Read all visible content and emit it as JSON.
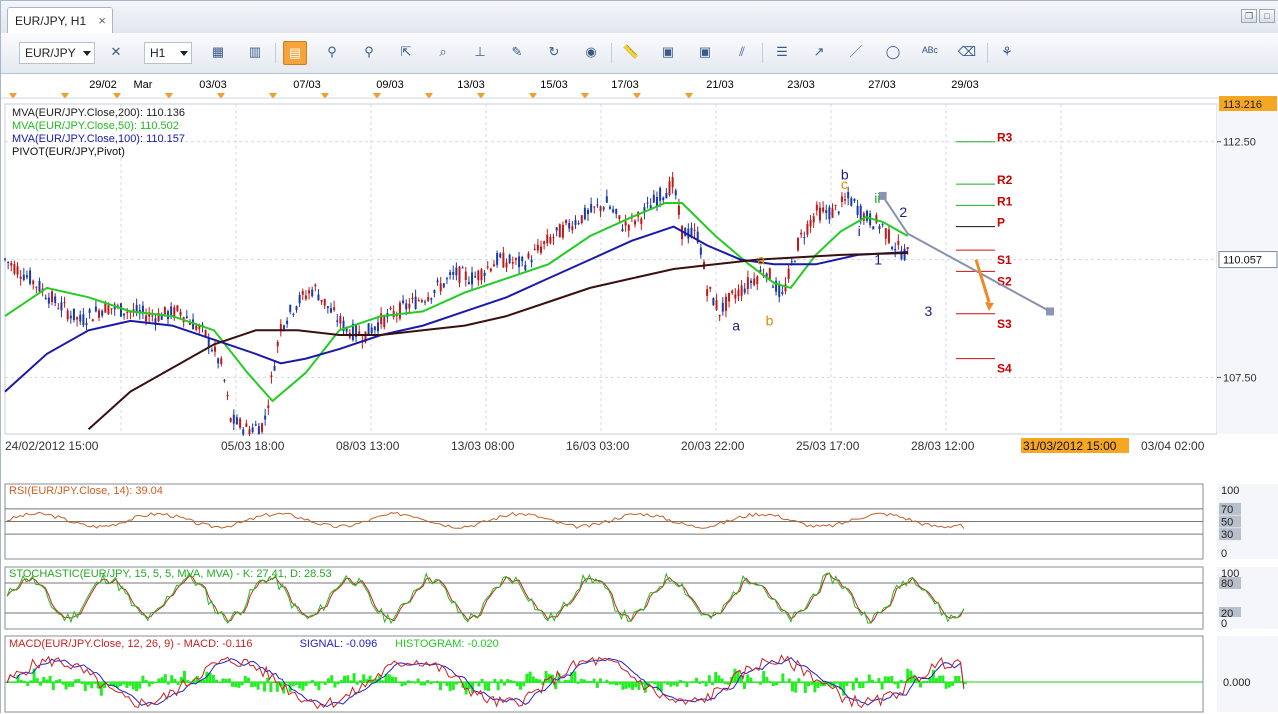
{
  "window": {
    "tab_title": "EUR/JPY, H1",
    "close_glyph": "×",
    "restore_glyph": "❐",
    "maximize_glyph": "□"
  },
  "toolbar": {
    "symbol": "EUR/JPY",
    "timeframe": "H1",
    "icons": [
      "bar-chart-icon",
      "crosshair-icon",
      "candle-view-icon",
      "line-view-icon",
      "zoom-in-icon",
      "zoom-out-icon",
      "cursor-icon",
      "zoom-area-icon",
      "indicator-icon",
      "draw-icon",
      "refresh-icon",
      "globe-icon",
      "ruler-icon",
      "template-icon",
      "screenshot-icon",
      "fibonacci-icon",
      "channel-icon",
      "trend-tool-icon",
      "line-tool-icon",
      "ellipse-icon",
      "text-tool-icon",
      "eraser-icon",
      "objects-icon"
    ]
  },
  "top_dates": [
    "29/02",
    "Mar",
    "03/03",
    "07/03",
    "09/03",
    "13/03",
    "15/03",
    "17/03",
    "21/03",
    "23/03",
    "27/03",
    "29/03"
  ],
  "legend": [
    {
      "text": "MVA(EUR/JPY.Close,200): 110.136",
      "color": "#222222"
    },
    {
      "text": "MVA(EUR/JPY.Close,50): 110.502",
      "color": "#22bb22"
    },
    {
      "text": "MVA(EUR/JPY.Close,100): 110.157",
      "color": "#1a1aaa"
    },
    {
      "text": "PIVOT(EUR/JPY,Pivot)",
      "color": "#111111"
    }
  ],
  "chart_data": [
    {
      "type": "candlestick",
      "title": "EUR/JPY, H1",
      "y_ticks": [
        112.5,
        110.0,
        107.5
      ],
      "y_tick_labels": [
        "112.50",
        "110.057",
        "107.50"
      ],
      "ylim": [
        106.3,
        113.3
      ],
      "current_price": "110.057",
      "top_price": "113.216",
      "x_tick_labels": [
        "24/02/2012 15:00",
        "05/03 18:00",
        "08/03 13:00",
        "13/03 08:00",
        "16/03 03:00",
        "20/03 22:00",
        "25/03 17:00",
        "28/03 12:00",
        "31/03/2012 15:00",
        "03/04 02:00"
      ],
      "close_path": [
        [
          0,
          110.0
        ],
        [
          6,
          109.6
        ],
        [
          12,
          109.1
        ],
        [
          18,
          108.7
        ],
        [
          24,
          109.0
        ],
        [
          30,
          108.9
        ],
        [
          36,
          108.8
        ],
        [
          42,
          108.9
        ],
        [
          48,
          108.4
        ],
        [
          52,
          107.7
        ],
        [
          54,
          106.6
        ],
        [
          58,
          106.4
        ],
        [
          62,
          106.5
        ],
        [
          66,
          108.6
        ],
        [
          70,
          109.1
        ],
        [
          74,
          109.4
        ],
        [
          78,
          108.9
        ],
        [
          82,
          108.5
        ],
        [
          86,
          108.4
        ],
        [
          90,
          108.7
        ],
        [
          96,
          109.0
        ],
        [
          102,
          109.3
        ],
        [
          108,
          109.7
        ],
        [
          112,
          109.6
        ],
        [
          118,
          110.0
        ],
        [
          124,
          109.9
        ],
        [
          130,
          110.4
        ],
        [
          136,
          110.8
        ],
        [
          140,
          111.0
        ],
        [
          144,
          111.2
        ],
        [
          148,
          110.7
        ],
        [
          152,
          110.9
        ],
        [
          156,
          111.3
        ],
        [
          160,
          111.6
        ],
        [
          162,
          110.6
        ],
        [
          166,
          110.5
        ],
        [
          168,
          109.4
        ],
        [
          171,
          108.9
        ],
        [
          174,
          109.2
        ],
        [
          178,
          109.5
        ],
        [
          182,
          109.8
        ],
        [
          186,
          109.2
        ],
        [
          190,
          110.4
        ],
        [
          194,
          111.0
        ],
        [
          198,
          111.0
        ],
        [
          202,
          111.3
        ],
        [
          206,
          110.9
        ],
        [
          210,
          110.7
        ],
        [
          212,
          110.4
        ],
        [
          214,
          110.2
        ],
        [
          216,
          110.1
        ]
      ],
      "x_total": 290,
      "series": [
        {
          "name": "MVA(EUR/JPY.Close,50)",
          "color": "#22cc22",
          "values": [
            [
              0,
              108.8
            ],
            [
              10,
              109.4
            ],
            [
              20,
              109.2
            ],
            [
              30,
              108.9
            ],
            [
              40,
              108.8
            ],
            [
              50,
              108.5
            ],
            [
              58,
              107.6
            ],
            [
              64,
              107.0
            ],
            [
              72,
              107.6
            ],
            [
              80,
              108.5
            ],
            [
              90,
              108.8
            ],
            [
              100,
              108.9
            ],
            [
              110,
              109.3
            ],
            [
              120,
              109.6
            ],
            [
              130,
              109.9
            ],
            [
              140,
              110.5
            ],
            [
              150,
              110.9
            ],
            [
              158,
              111.2
            ],
            [
              162,
              111.2
            ],
            [
              170,
              110.5
            ],
            [
              178,
              109.9
            ],
            [
              184,
              109.5
            ],
            [
              188,
              109.4
            ],
            [
              194,
              110.1
            ],
            [
              200,
              110.6
            ],
            [
              206,
              110.9
            ],
            [
              210,
              110.8
            ],
            [
              216,
              110.5
            ]
          ]
        },
        {
          "name": "MVA(EUR/JPY.Close,100)",
          "color": "#1a1aaa",
          "values": [
            [
              0,
              107.2
            ],
            [
              10,
              108.0
            ],
            [
              20,
              108.5
            ],
            [
              30,
              108.7
            ],
            [
              40,
              108.6
            ],
            [
              50,
              108.3
            ],
            [
              60,
              108.0
            ],
            [
              66,
              107.8
            ],
            [
              72,
              107.9
            ],
            [
              80,
              108.1
            ],
            [
              90,
              108.4
            ],
            [
              100,
              108.6
            ],
            [
              110,
              108.9
            ],
            [
              120,
              109.2
            ],
            [
              130,
              109.6
            ],
            [
              140,
              110.0
            ],
            [
              150,
              110.4
            ],
            [
              160,
              110.7
            ],
            [
              168,
              110.3
            ],
            [
              176,
              110.0
            ],
            [
              184,
              109.9
            ],
            [
              194,
              109.9
            ],
            [
              204,
              110.1
            ],
            [
              216,
              110.16
            ]
          ]
        },
        {
          "name": "MVA(EUR/JPY.Close,200)",
          "color": "#3a1010",
          "values": [
            [
              20,
              106.4
            ],
            [
              30,
              107.2
            ],
            [
              40,
              107.7
            ],
            [
              50,
              108.2
            ],
            [
              60,
              108.5
            ],
            [
              70,
              108.5
            ],
            [
              80,
              108.4
            ],
            [
              90,
              108.4
            ],
            [
              100,
              108.5
            ],
            [
              110,
              108.6
            ],
            [
              120,
              108.8
            ],
            [
              130,
              109.1
            ],
            [
              140,
              109.4
            ],
            [
              150,
              109.6
            ],
            [
              160,
              109.8
            ],
            [
              170,
              109.9
            ],
            [
              180,
              110.0
            ],
            [
              190,
              110.05
            ],
            [
              200,
              110.1
            ],
            [
              216,
              110.14
            ]
          ]
        }
      ],
      "pivot_levels": [
        {
          "name": "R3",
          "value": 112.5
        },
        {
          "name": "R2",
          "value": 111.6
        },
        {
          "name": "R1",
          "value": 111.15
        },
        {
          "name": "P",
          "value": 110.7
        },
        {
          "name": "S1",
          "value": 110.2
        },
        {
          "name": "S2",
          "value": 109.75
        },
        {
          "name": "S3",
          "value": 108.85
        },
        {
          "name": "S4",
          "value": 107.9
        }
      ],
      "annotations": [
        {
          "text": "a",
          "x": 174,
          "y": 108.5,
          "color": "#1a1a88"
        },
        {
          "text": "b",
          "x": 182,
          "y": 108.6,
          "color": "#e08a00"
        },
        {
          "text": "a",
          "x": 180,
          "y": 109.9,
          "color": "#e08a00"
        },
        {
          "text": "b",
          "x": 200,
          "y": 111.7,
          "color": "#1a1a88"
        },
        {
          "text": "c",
          "x": 200,
          "y": 111.5,
          "color": "#e08a00"
        },
        {
          "text": "ii",
          "x": 208,
          "y": 111.2,
          "color": "#22aa22"
        },
        {
          "text": "i",
          "x": 204,
          "y": 110.5,
          "color": "#1a1a88"
        },
        {
          "text": "1",
          "x": 208,
          "y": 109.9,
          "color": "#1a1a88"
        },
        {
          "text": "2",
          "x": 214,
          "y": 110.9,
          "color": "#1a1a88"
        },
        {
          "text": "3",
          "x": 220,
          "y": 108.8,
          "color": "#1a1a88"
        }
      ]
    },
    {
      "type": "line",
      "title": "RSI(EUR/JPY.Close, 14): 39.04",
      "y_tick_labels": [
        "100",
        "70",
        "50",
        "30",
        "0"
      ],
      "ylim": [
        0,
        100
      ],
      "current": 39.04
    },
    {
      "type": "line",
      "title": "STOCHASTIC(EUR/JPY, 15, 5, 5, MVA, MVA) -  K: 27.41, D: 28.53",
      "y_tick_labels": [
        "100",
        "80",
        "20",
        "0"
      ],
      "ylim": [
        0,
        100
      ],
      "k": 27.41,
      "d": 28.53
    },
    {
      "type": "line",
      "title_parts": [
        {
          "text": "MACD(EUR/JPY.Close, 12, 26, 9) -  MACD: -0.116",
          "color": "#cc2222"
        },
        {
          "text": "SIGNAL: -0.096",
          "color": "#2222cc"
        },
        {
          "text": "HISTOGRAM: -0.020",
          "color": "#22cc22"
        }
      ],
      "y_tick_labels": [
        "0.000"
      ],
      "macd": -0.116,
      "signal": -0.096,
      "histogram": -0.02
    }
  ]
}
